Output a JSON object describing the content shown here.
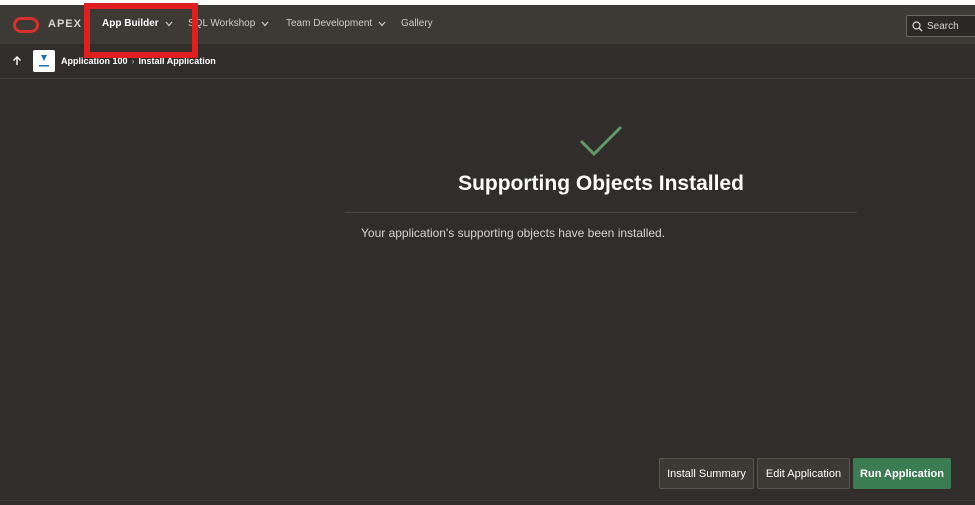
{
  "header": {
    "logo_text": "APEX",
    "nav": [
      {
        "label": "App Builder",
        "active": true
      },
      {
        "label": "SQL Workshop",
        "active": false
      },
      {
        "label": "Team Development",
        "active": false
      },
      {
        "label": "Gallery",
        "active": false
      }
    ],
    "search_label": "Search"
  },
  "breadcrumb": {
    "items": [
      "Application 100",
      "Install Application"
    ]
  },
  "main": {
    "icon": "checkmark-icon",
    "title": "Supporting Objects Installed",
    "message": "Your application's supporting objects have been installed."
  },
  "buttons": {
    "install_summary": "Install Summary",
    "edit_application": "Edit Application",
    "run_application": "Run Application"
  },
  "colors": {
    "highlight": "#e02020",
    "primary_button": "#3c7c53",
    "checkmark": "#5e9a6a",
    "logo": "#d6302a"
  }
}
